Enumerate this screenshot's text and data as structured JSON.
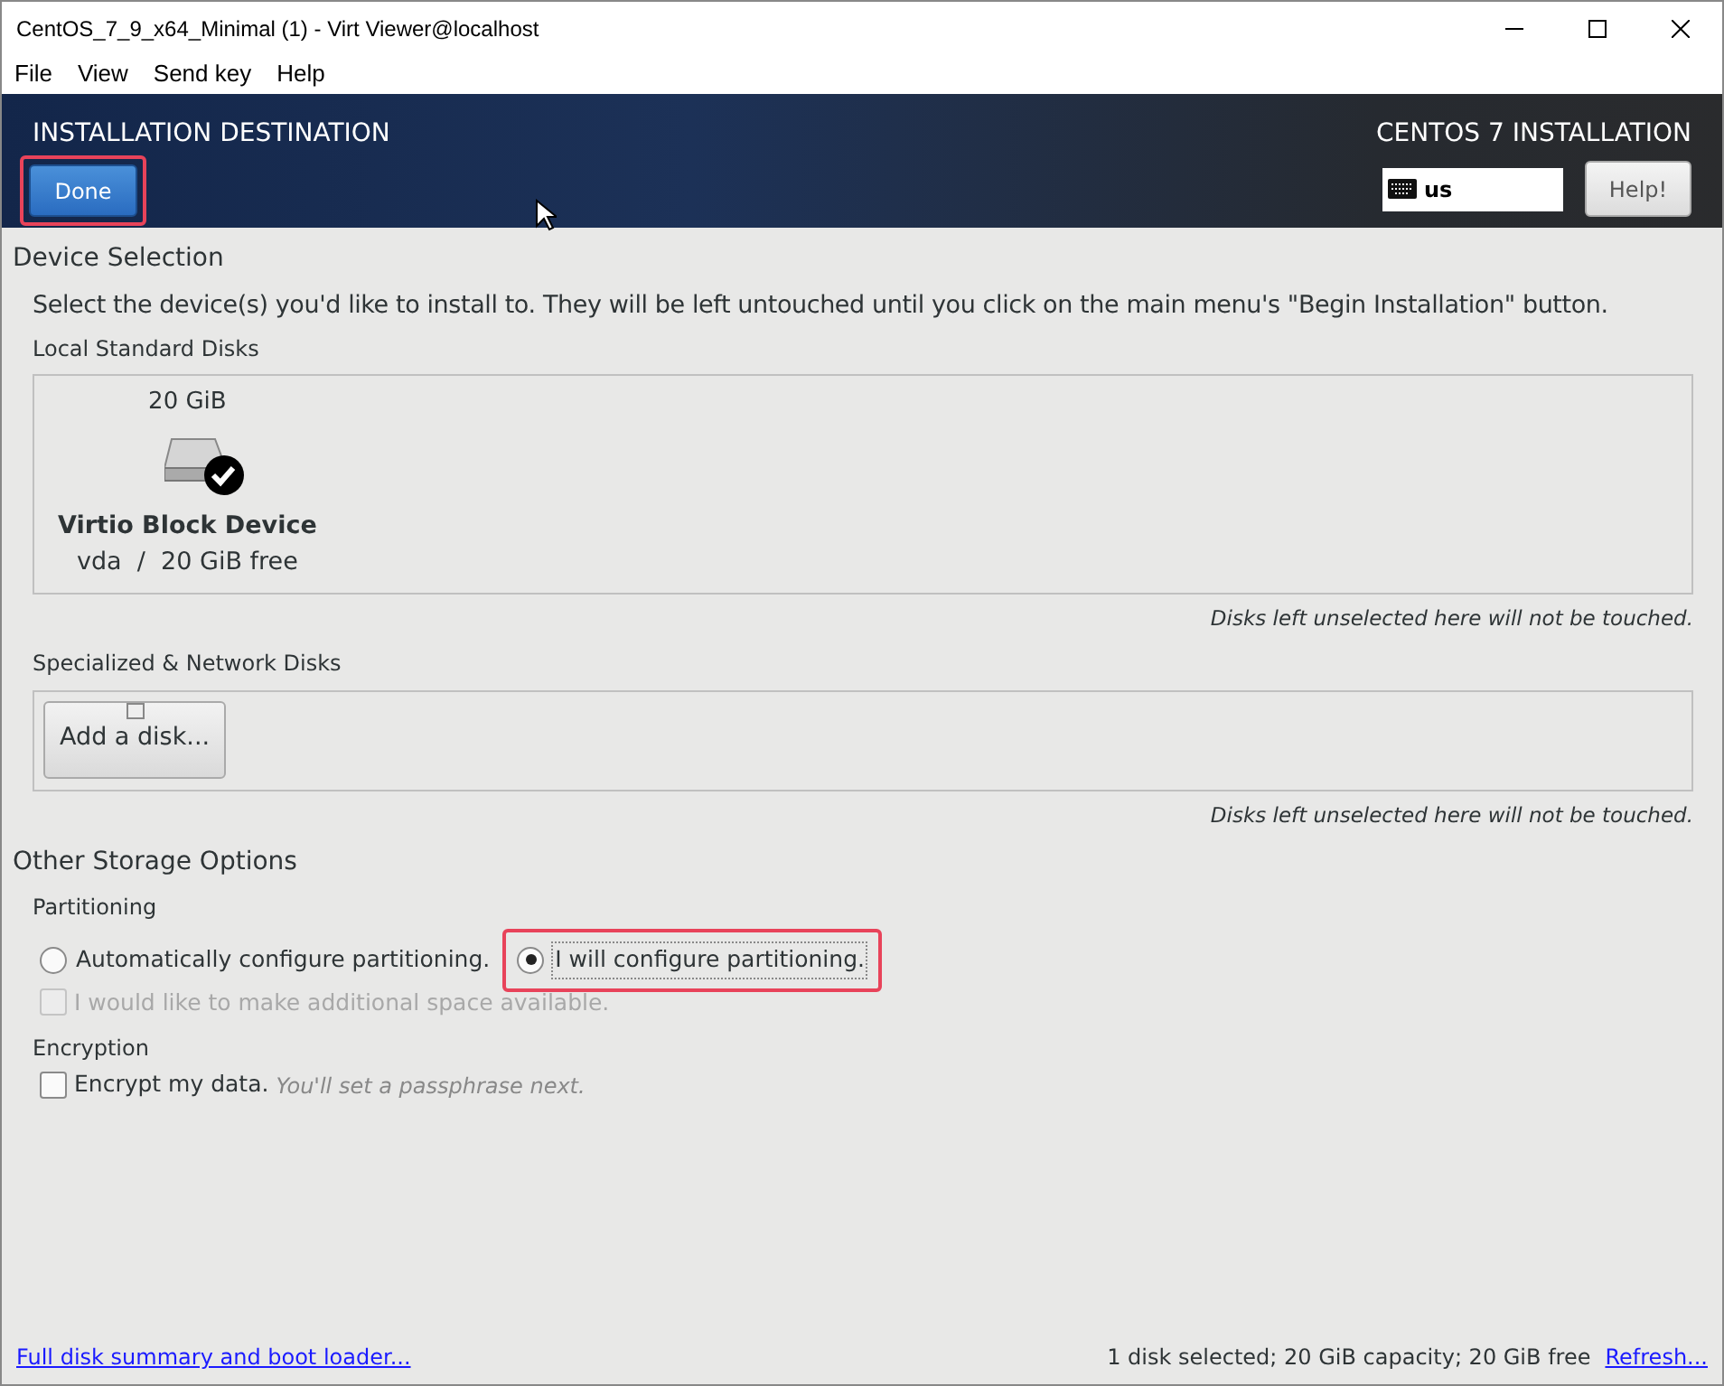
{
  "window": {
    "title": "CentOS_7_9_x64_Minimal (1) - Virt Viewer@localhost"
  },
  "menu": [
    "File",
    "View",
    "Send key",
    "Help"
  ],
  "header": {
    "title": "INSTALLATION DESTINATION",
    "done": "Done",
    "product": "CENTOS 7 INSTALLATION",
    "keyboard": "us",
    "help": "Help!"
  },
  "device_selection": {
    "title": "Device Selection",
    "intro": "Select the device(s) you'd like to install to.  They will be left untouched until you click on the main menu's \"Begin Installation\" button.",
    "local_title": "Local Standard Disks",
    "disks": [
      {
        "size": "20 GiB",
        "name": "Virtio Block Device",
        "detail": "vda  /  20 GiB free",
        "selected": true
      }
    ],
    "local_note": "Disks left unselected here will not be touched.",
    "network_title": "Specialized & Network Disks",
    "add_disk": "Add a disk...",
    "network_note": "Disks left unselected here will not be touched."
  },
  "other": {
    "title": "Other Storage Options",
    "partitioning_title": "Partitioning",
    "partitioning": [
      {
        "label": "Automatically configure partitioning.",
        "selected": false
      },
      {
        "label": "I will configure partitioning.",
        "selected": true
      }
    ],
    "extra_space": {
      "label": "I would like to make additional space available.",
      "checked": false,
      "disabled": true
    },
    "encryption_title": "Encryption",
    "encrypt": {
      "label": "Encrypt my data.",
      "hint": "You'll set a passphrase next.",
      "checked": false
    }
  },
  "footer": {
    "link": "Full disk summary and boot loader...",
    "summary": "1 disk selected; 20 GiB capacity; 20 GiB free",
    "refresh": "Refresh..."
  }
}
